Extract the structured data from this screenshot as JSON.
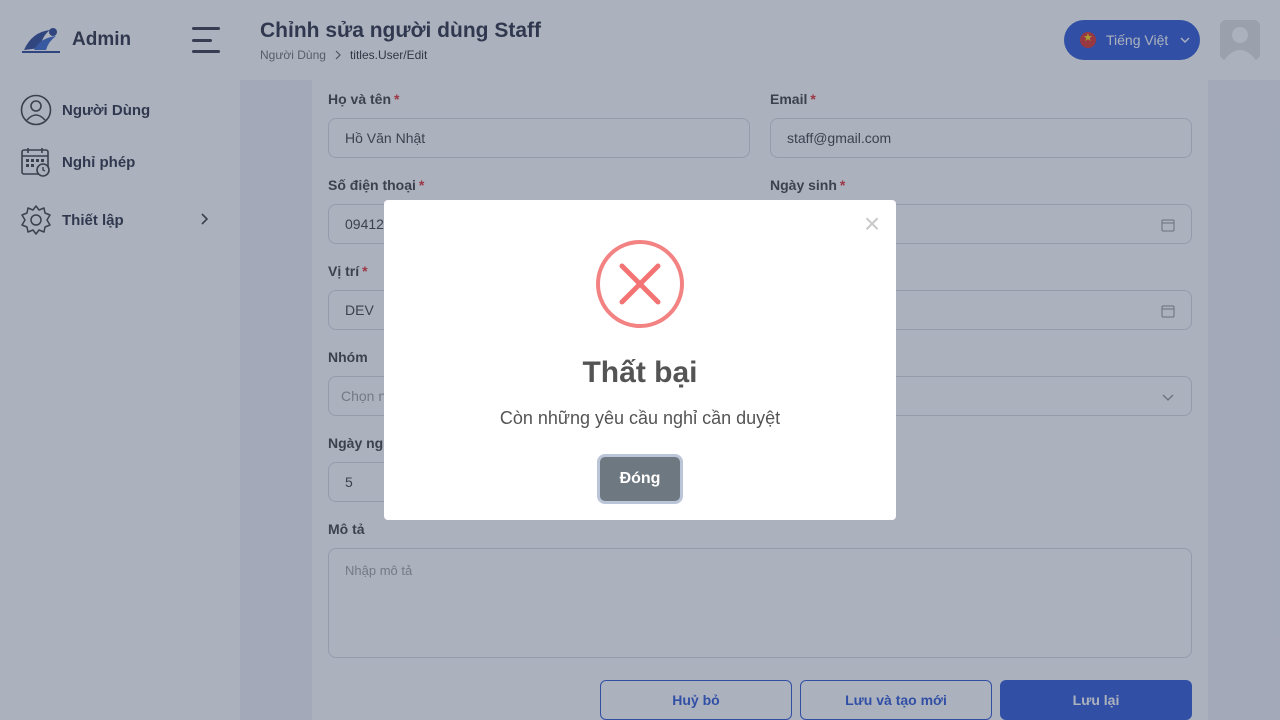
{
  "sidebar": {
    "brand": "Admin",
    "items": [
      {
        "label": "Người Dùng",
        "icon": "user-circle-icon"
      },
      {
        "label": "Nghỉ phép",
        "icon": "calendar-icon"
      },
      {
        "label": "Thiết lập",
        "icon": "gear-icon"
      }
    ]
  },
  "header": {
    "title": "Chỉnh sửa người dùng Staff",
    "breadcrumb": [
      "Người Dùng",
      "titles.User/Edit"
    ],
    "language": "Tiếng Việt"
  },
  "form": {
    "full_name": {
      "label": "Họ và tên",
      "value": "Hồ Văn Nhật"
    },
    "email": {
      "label": "Email",
      "value": "staff@gmail.com"
    },
    "phone": {
      "label": "Số điện thoại",
      "value": "09412"
    },
    "birthday": {
      "label": "Ngày sinh",
      "value": ""
    },
    "position": {
      "label": "Vị trí",
      "value": "DEV"
    },
    "group": {
      "label": "Nhóm",
      "placeholder": "Chọn n"
    },
    "leave_days": {
      "label": "Ngày ngh",
      "value": "5"
    },
    "description": {
      "label": "Mô tả",
      "placeholder": "Nhập mô tả"
    },
    "required_mark": "*"
  },
  "actions": {
    "cancel": "Huỷ bỏ",
    "save_new": "Lưu và tạo mới",
    "save": "Lưu lại"
  },
  "modal": {
    "title": "Thất bại",
    "message": "Còn những yêu cầu nghỉ cần duyệt",
    "close_label": "Đóng",
    "close_x": "×"
  },
  "colors": {
    "primary": "#1f4fd1",
    "error": "#f27474",
    "modal_button": "#6e7881"
  }
}
